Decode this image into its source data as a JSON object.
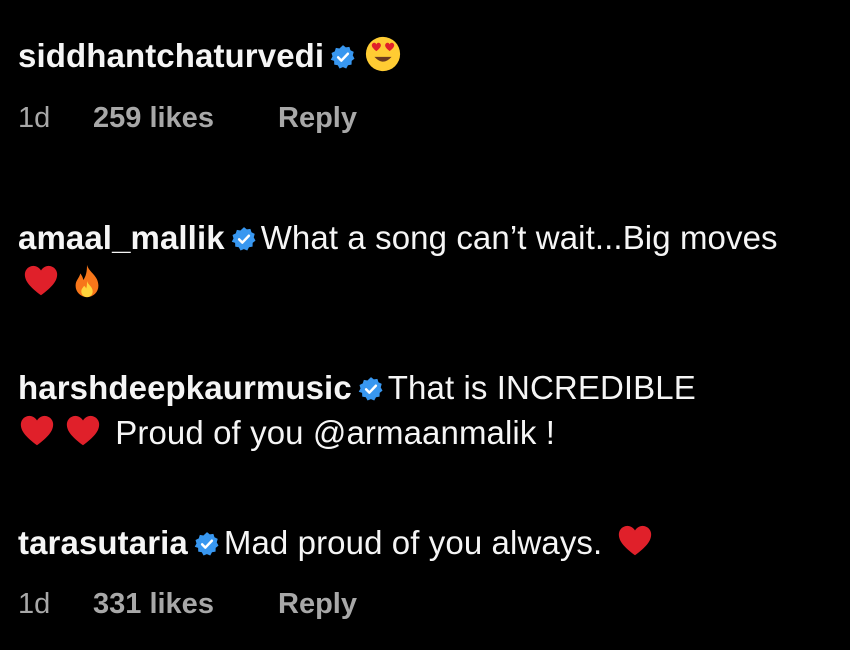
{
  "comments": [
    {
      "username": "siddhantchaturvedi",
      "text": "",
      "emojis": [
        "heart-eyes-emoji"
      ],
      "time": "1d",
      "likes": "259 likes",
      "reply": "Reply"
    },
    {
      "username": "amaal_mallik",
      "text": "What a song can’t wait...Big moves",
      "emojis": [
        "red-heart-emoji",
        "fire-emoji"
      ]
    },
    {
      "username": "harshdeepkaurmusic",
      "text_a": "That is INCREDIBLE",
      "text_b": "Proud of you @armaanmalik !",
      "emojis": [
        "red-heart-emoji",
        "red-heart-emoji"
      ]
    },
    {
      "username": "tarasutaria",
      "text": "Mad proud of you always.",
      "emojis": [
        "red-heart-emoji"
      ],
      "time": "1d",
      "likes": "331 likes",
      "reply": "Reply"
    }
  ],
  "colors": {
    "background": "#000000",
    "text": "#f5f5f5",
    "meta": "#a8a8a8",
    "verified": "#3897f0",
    "heart": "#e0202a"
  }
}
